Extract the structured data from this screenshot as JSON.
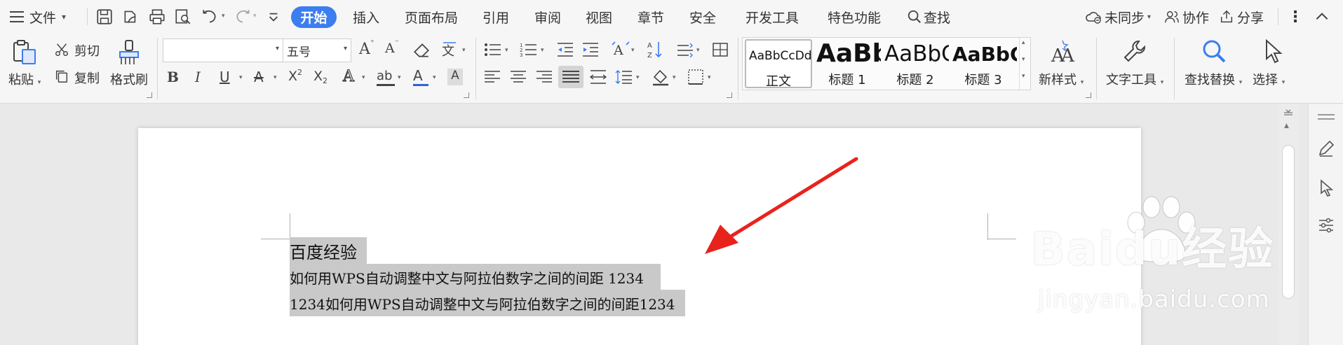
{
  "menubar": {
    "file_menu": "文件",
    "tabs": [
      "开始",
      "插入",
      "页面布局",
      "引用",
      "审阅",
      "视图",
      "章节",
      "安全",
      "开发工具",
      "特色功能"
    ],
    "active_tab": "开始",
    "search": "查找",
    "sync": "未同步",
    "collab": "协作",
    "share": "分享",
    "accent": "#3c7df0"
  },
  "ribbon": {
    "clipboard": {
      "paste": "粘贴",
      "cut": "剪切",
      "copy": "复制",
      "format_painter": "格式刷"
    },
    "font": {
      "family_value": "",
      "size_value": "五号"
    },
    "styles": [
      {
        "sample": "AaBbCcDd",
        "name": "正文"
      },
      {
        "sample": "AaBb",
        "name": "标题 1"
      },
      {
        "sample": "AaBbC",
        "name": "标题 2"
      },
      {
        "sample": "AaBbC",
        "name": "标题 3"
      }
    ],
    "new_style": "新样式",
    "text_tools": "文字工具",
    "find_replace": "查找替换",
    "select": "选择"
  },
  "document": {
    "lines": [
      "百度经验",
      "如何用WPS自动调整中文与阿拉伯数字之间的间距 1234",
      "1234如何用WPS自动调整中文与阿拉伯数字之间的间距1234"
    ],
    "selection_color": "#c9c9c9",
    "annotation_color": "#e8231c"
  },
  "watermark": {
    "brand": "Baidu经验",
    "url": "jingyan.baidu.com"
  }
}
